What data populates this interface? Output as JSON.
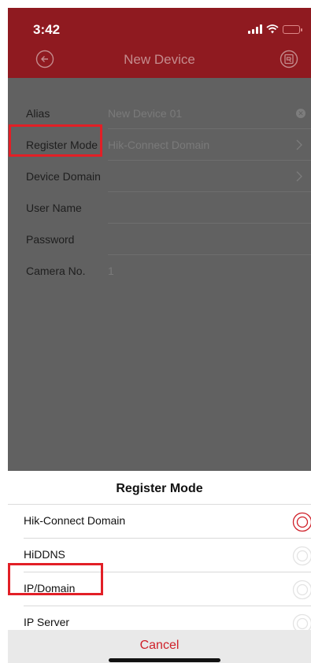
{
  "status_bar": {
    "time": "3:42"
  },
  "nav": {
    "title": "New Device"
  },
  "form": {
    "rows": [
      {
        "label": "Alias",
        "value": "New Device 01"
      },
      {
        "label": "Register Mode",
        "value": "Hik-Connect Domain"
      },
      {
        "label": "Device Domain",
        "value": ""
      },
      {
        "label": "User Name",
        "value": ""
      },
      {
        "label": "Password",
        "value": ""
      },
      {
        "label": "Camera No.",
        "value": "1"
      }
    ]
  },
  "sheet": {
    "title": "Register Mode",
    "options": [
      {
        "label": "Hik-Connect Domain",
        "selected": true
      },
      {
        "label": "HiDDNS",
        "selected": false
      },
      {
        "label": "IP/Domain",
        "selected": false
      },
      {
        "label": "IP Server",
        "selected": false
      }
    ],
    "cancel_label": "Cancel"
  },
  "colors": {
    "header": "#8f1a20",
    "overlay": "#616161",
    "highlight": "#e21f26",
    "cancel_text": "#cf2029",
    "radio_selected": "#cf2029"
  }
}
